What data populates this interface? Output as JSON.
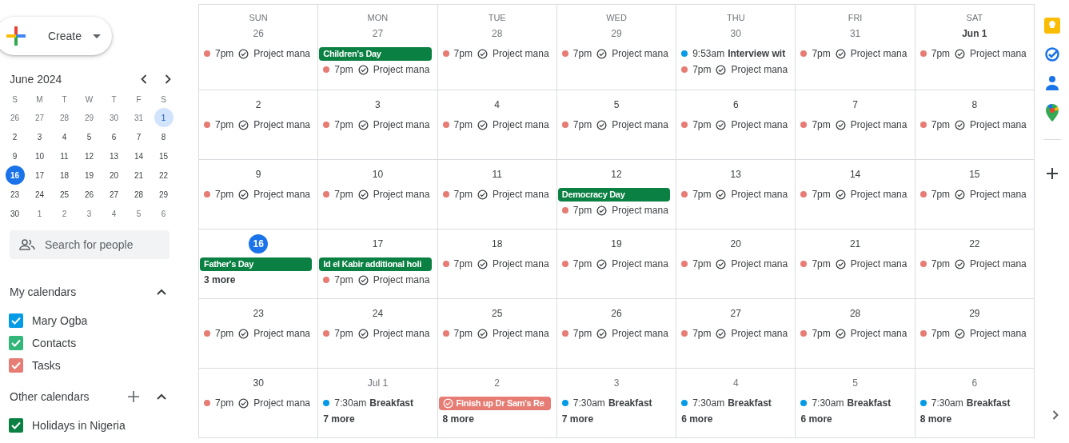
{
  "create_button": {
    "label": "Create"
  },
  "mini_calendar": {
    "title": "June 2024",
    "weekdays": [
      "S",
      "M",
      "T",
      "W",
      "T",
      "F",
      "S"
    ],
    "weeks": [
      [
        {
          "label": "26",
          "in_month": false,
          "today": false,
          "selected": false
        },
        {
          "label": "27",
          "in_month": false,
          "today": false,
          "selected": false
        },
        {
          "label": "28",
          "in_month": false,
          "today": false,
          "selected": false
        },
        {
          "label": "29",
          "in_month": false,
          "today": false,
          "selected": false
        },
        {
          "label": "30",
          "in_month": false,
          "today": false,
          "selected": false
        },
        {
          "label": "31",
          "in_month": false,
          "today": false,
          "selected": false
        },
        {
          "label": "1",
          "in_month": true,
          "today": false,
          "selected": true
        }
      ],
      [
        {
          "label": "2",
          "in_month": true,
          "today": false,
          "selected": false
        },
        {
          "label": "3",
          "in_month": true,
          "today": false,
          "selected": false
        },
        {
          "label": "4",
          "in_month": true,
          "today": false,
          "selected": false
        },
        {
          "label": "5",
          "in_month": true,
          "today": false,
          "selected": false
        },
        {
          "label": "6",
          "in_month": true,
          "today": false,
          "selected": false
        },
        {
          "label": "7",
          "in_month": true,
          "today": false,
          "selected": false
        },
        {
          "label": "8",
          "in_month": true,
          "today": false,
          "selected": false
        }
      ],
      [
        {
          "label": "9",
          "in_month": true,
          "today": false,
          "selected": false
        },
        {
          "label": "10",
          "in_month": true,
          "today": false,
          "selected": false
        },
        {
          "label": "11",
          "in_month": true,
          "today": false,
          "selected": false
        },
        {
          "label": "12",
          "in_month": true,
          "today": false,
          "selected": false
        },
        {
          "label": "13",
          "in_month": true,
          "today": false,
          "selected": false
        },
        {
          "label": "14",
          "in_month": true,
          "today": false,
          "selected": false
        },
        {
          "label": "15",
          "in_month": true,
          "today": false,
          "selected": false
        }
      ],
      [
        {
          "label": "16",
          "in_month": true,
          "today": true,
          "selected": false
        },
        {
          "label": "17",
          "in_month": true,
          "today": false,
          "selected": false
        },
        {
          "label": "18",
          "in_month": true,
          "today": false,
          "selected": false
        },
        {
          "label": "19",
          "in_month": true,
          "today": false,
          "selected": false
        },
        {
          "label": "20",
          "in_month": true,
          "today": false,
          "selected": false
        },
        {
          "label": "21",
          "in_month": true,
          "today": false,
          "selected": false
        },
        {
          "label": "22",
          "in_month": true,
          "today": false,
          "selected": false
        }
      ],
      [
        {
          "label": "23",
          "in_month": true,
          "today": false,
          "selected": false
        },
        {
          "label": "24",
          "in_month": true,
          "today": false,
          "selected": false
        },
        {
          "label": "25",
          "in_month": true,
          "today": false,
          "selected": false
        },
        {
          "label": "26",
          "in_month": true,
          "today": false,
          "selected": false
        },
        {
          "label": "27",
          "in_month": true,
          "today": false,
          "selected": false
        },
        {
          "label": "28",
          "in_month": true,
          "today": false,
          "selected": false
        },
        {
          "label": "29",
          "in_month": true,
          "today": false,
          "selected": false
        }
      ],
      [
        {
          "label": "30",
          "in_month": true,
          "today": false,
          "selected": false
        },
        {
          "label": "1",
          "in_month": false,
          "today": false,
          "selected": false
        },
        {
          "label": "2",
          "in_month": false,
          "today": false,
          "selected": false
        },
        {
          "label": "3",
          "in_month": false,
          "today": false,
          "selected": false
        },
        {
          "label": "4",
          "in_month": false,
          "today": false,
          "selected": false
        },
        {
          "label": "5",
          "in_month": false,
          "today": false,
          "selected": false
        },
        {
          "label": "6",
          "in_month": false,
          "today": false,
          "selected": false
        }
      ]
    ]
  },
  "search": {
    "placeholder": "Search for people"
  },
  "my_calendars": {
    "title": "My calendars",
    "expanded": true,
    "items": [
      {
        "label": "Mary Ogba",
        "checked": true,
        "color": "#039be5"
      },
      {
        "label": "Contacts",
        "checked": true,
        "color": "#33b679"
      },
      {
        "label": "Tasks",
        "checked": true,
        "color": "#e67c73"
      }
    ]
  },
  "other_calendars": {
    "title": "Other calendars",
    "expanded": true,
    "items": [
      {
        "label": "Holidays in Nigeria",
        "checked": true,
        "color": "#0b8043"
      }
    ]
  },
  "month_grid": {
    "weekdays": [
      "SUN",
      "MON",
      "TUE",
      "WED",
      "THU",
      "FRI",
      "SAT"
    ],
    "weeks": [
      [
        {
          "date": "26",
          "in_month": false,
          "today": false,
          "events": [
            {
              "kind": "task",
              "time": "7pm",
              "title": "Project mana",
              "color": "#e67c73"
            }
          ]
        },
        {
          "date": "27",
          "in_month": false,
          "today": false,
          "events": [
            {
              "kind": "allday",
              "title": "Children's Day",
              "color": "#0b8043"
            },
            {
              "kind": "task",
              "time": "7pm",
              "title": "Project mana",
              "color": "#e67c73"
            }
          ]
        },
        {
          "date": "28",
          "in_month": false,
          "today": false,
          "events": [
            {
              "kind": "task",
              "time": "7pm",
              "title": "Project mana",
              "color": "#e67c73"
            }
          ]
        },
        {
          "date": "29",
          "in_month": false,
          "today": false,
          "events": [
            {
              "kind": "task",
              "time": "7pm",
              "title": "Project mana",
              "color": "#e67c73"
            }
          ]
        },
        {
          "date": "30",
          "in_month": false,
          "today": false,
          "events": [
            {
              "kind": "timed",
              "time": "9:53am",
              "title": "Interview wit",
              "color": "#039be5"
            },
            {
              "kind": "task",
              "time": "7pm",
              "title": "Project mana",
              "color": "#e67c73"
            }
          ]
        },
        {
          "date": "31",
          "in_month": false,
          "today": false,
          "events": [
            {
              "kind": "task",
              "time": "7pm",
              "title": "Project mana",
              "color": "#e67c73"
            }
          ]
        },
        {
          "date": "Jun 1",
          "in_month": true,
          "today": false,
          "events": [
            {
              "kind": "task",
              "time": "7pm",
              "title": "Project mana",
              "color": "#e67c73"
            }
          ]
        }
      ],
      [
        {
          "date": "2",
          "in_month": true,
          "today": false,
          "events": [
            {
              "kind": "task",
              "time": "7pm",
              "title": "Project mana",
              "color": "#e67c73"
            }
          ]
        },
        {
          "date": "3",
          "in_month": true,
          "today": false,
          "events": [
            {
              "kind": "task",
              "time": "7pm",
              "title": "Project mana",
              "color": "#e67c73"
            }
          ]
        },
        {
          "date": "4",
          "in_month": true,
          "today": false,
          "events": [
            {
              "kind": "task",
              "time": "7pm",
              "title": "Project mana",
              "color": "#e67c73"
            }
          ]
        },
        {
          "date": "5",
          "in_month": true,
          "today": false,
          "events": [
            {
              "kind": "task",
              "time": "7pm",
              "title": "Project mana",
              "color": "#e67c73"
            }
          ]
        },
        {
          "date": "6",
          "in_month": true,
          "today": false,
          "events": [
            {
              "kind": "task",
              "time": "7pm",
              "title": "Project mana",
              "color": "#e67c73"
            }
          ]
        },
        {
          "date": "7",
          "in_month": true,
          "today": false,
          "events": [
            {
              "kind": "task",
              "time": "7pm",
              "title": "Project mana",
              "color": "#e67c73"
            }
          ]
        },
        {
          "date": "8",
          "in_month": true,
          "today": false,
          "events": [
            {
              "kind": "task",
              "time": "7pm",
              "title": "Project mana",
              "color": "#e67c73"
            }
          ]
        }
      ],
      [
        {
          "date": "9",
          "in_month": true,
          "today": false,
          "events": [
            {
              "kind": "task",
              "time": "7pm",
              "title": "Project mana",
              "color": "#e67c73"
            }
          ]
        },
        {
          "date": "10",
          "in_month": true,
          "today": false,
          "events": [
            {
              "kind": "task",
              "time": "7pm",
              "title": "Project mana",
              "color": "#e67c73"
            }
          ]
        },
        {
          "date": "11",
          "in_month": true,
          "today": false,
          "events": [
            {
              "kind": "task",
              "time": "7pm",
              "title": "Project mana",
              "color": "#e67c73"
            }
          ]
        },
        {
          "date": "12",
          "in_month": true,
          "today": false,
          "events": [
            {
              "kind": "allday",
              "title": "Democracy Day",
              "color": "#0b8043"
            },
            {
              "kind": "task",
              "time": "7pm",
              "title": "Project mana",
              "color": "#e67c73"
            }
          ]
        },
        {
          "date": "13",
          "in_month": true,
          "today": false,
          "events": [
            {
              "kind": "task",
              "time": "7pm",
              "title": "Project mana",
              "color": "#e67c73"
            }
          ]
        },
        {
          "date": "14",
          "in_month": true,
          "today": false,
          "events": [
            {
              "kind": "task",
              "time": "7pm",
              "title": "Project mana",
              "color": "#e67c73"
            }
          ]
        },
        {
          "date": "15",
          "in_month": true,
          "today": false,
          "events": [
            {
              "kind": "task",
              "time": "7pm",
              "title": "Project mana",
              "color": "#e67c73"
            }
          ]
        }
      ],
      [
        {
          "date": "16",
          "in_month": true,
          "today": true,
          "events": [
            {
              "kind": "allday",
              "title": "Father's Day",
              "color": "#0b8043"
            },
            {
              "kind": "more",
              "title": "3 more"
            }
          ]
        },
        {
          "date": "17",
          "in_month": true,
          "today": false,
          "events": [
            {
              "kind": "allday",
              "title": "Id el Kabir additional holi",
              "color": "#0b8043"
            },
            {
              "kind": "task",
              "time": "7pm",
              "title": "Project mana",
              "color": "#e67c73"
            }
          ]
        },
        {
          "date": "18",
          "in_month": true,
          "today": false,
          "events": [
            {
              "kind": "task",
              "time": "7pm",
              "title": "Project mana",
              "color": "#e67c73"
            }
          ]
        },
        {
          "date": "19",
          "in_month": true,
          "today": false,
          "events": [
            {
              "kind": "task",
              "time": "7pm",
              "title": "Project mana",
              "color": "#e67c73"
            }
          ]
        },
        {
          "date": "20",
          "in_month": true,
          "today": false,
          "events": [
            {
              "kind": "task",
              "time": "7pm",
              "title": "Project mana",
              "color": "#e67c73"
            }
          ]
        },
        {
          "date": "21",
          "in_month": true,
          "today": false,
          "events": [
            {
              "kind": "task",
              "time": "7pm",
              "title": "Project mana",
              "color": "#e67c73"
            }
          ]
        },
        {
          "date": "22",
          "in_month": true,
          "today": false,
          "events": [
            {
              "kind": "task",
              "time": "7pm",
              "title": "Project mana",
              "color": "#e67c73"
            }
          ]
        }
      ],
      [
        {
          "date": "23",
          "in_month": true,
          "today": false,
          "events": [
            {
              "kind": "task",
              "time": "7pm",
              "title": "Project mana",
              "color": "#e67c73"
            }
          ]
        },
        {
          "date": "24",
          "in_month": true,
          "today": false,
          "events": [
            {
              "kind": "task",
              "time": "7pm",
              "title": "Project mana",
              "color": "#e67c73"
            }
          ]
        },
        {
          "date": "25",
          "in_month": true,
          "today": false,
          "events": [
            {
              "kind": "task",
              "time": "7pm",
              "title": "Project mana",
              "color": "#e67c73"
            }
          ]
        },
        {
          "date": "26",
          "in_month": true,
          "today": false,
          "events": [
            {
              "kind": "task",
              "time": "7pm",
              "title": "Project mana",
              "color": "#e67c73"
            }
          ]
        },
        {
          "date": "27",
          "in_month": true,
          "today": false,
          "events": [
            {
              "kind": "task",
              "time": "7pm",
              "title": "Project mana",
              "color": "#e67c73"
            }
          ]
        },
        {
          "date": "28",
          "in_month": true,
          "today": false,
          "events": [
            {
              "kind": "task",
              "time": "7pm",
              "title": "Project mana",
              "color": "#e67c73"
            }
          ]
        },
        {
          "date": "29",
          "in_month": true,
          "today": false,
          "events": [
            {
              "kind": "task",
              "time": "7pm",
              "title": "Project mana",
              "color": "#e67c73"
            }
          ]
        }
      ],
      [
        {
          "date": "30",
          "in_month": true,
          "today": false,
          "events": [
            {
              "kind": "task",
              "time": "7pm",
              "title": "Project mana",
              "color": "#e67c73"
            }
          ]
        },
        {
          "date": "Jul 1",
          "in_month": false,
          "today": false,
          "events": [
            {
              "kind": "timed",
              "time": "7:30am",
              "title": "Breakfast",
              "color": "#039be5"
            },
            {
              "kind": "more",
              "title": "7 more"
            }
          ]
        },
        {
          "date": "2",
          "in_month": false,
          "today": false,
          "events": [
            {
              "kind": "task_chip",
              "title": "Finish up Dr Sam's Re",
              "color": "#e67c73"
            },
            {
              "kind": "more",
              "title": "8 more"
            }
          ]
        },
        {
          "date": "3",
          "in_month": false,
          "today": false,
          "events": [
            {
              "kind": "timed",
              "time": "7:30am",
              "title": "Breakfast",
              "color": "#039be5"
            },
            {
              "kind": "more",
              "title": "7 more"
            }
          ]
        },
        {
          "date": "4",
          "in_month": false,
          "today": false,
          "events": [
            {
              "kind": "timed",
              "time": "7:30am",
              "title": "Breakfast",
              "color": "#039be5"
            },
            {
              "kind": "more",
              "title": "6 more"
            }
          ]
        },
        {
          "date": "5",
          "in_month": false,
          "today": false,
          "events": [
            {
              "kind": "timed",
              "time": "7:30am",
              "title": "Breakfast",
              "color": "#039be5"
            },
            {
              "kind": "more",
              "title": "6 more"
            }
          ]
        },
        {
          "date": "6",
          "in_month": false,
          "today": false,
          "events": [
            {
              "kind": "timed",
              "time": "7:30am",
              "title": "Breakfast",
              "color": "#039be5"
            },
            {
              "kind": "more",
              "title": "8 more"
            }
          ]
        }
      ]
    ]
  }
}
